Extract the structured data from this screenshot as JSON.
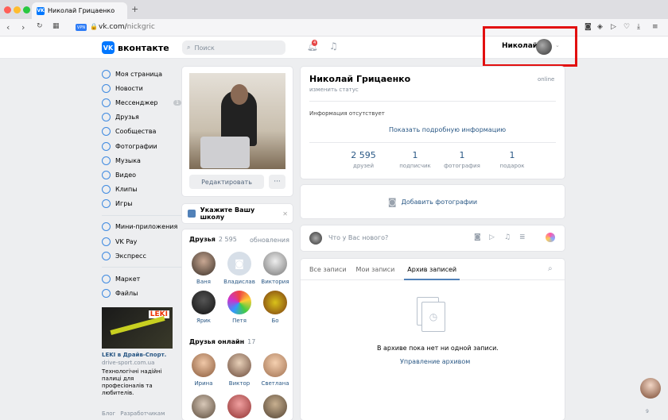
{
  "browser": {
    "tab_title": "Николай Грицаенко",
    "new_tab": "+",
    "url_host": "vk.com/",
    "url_path": "nickgric",
    "vpn": "VPN"
  },
  "header": {
    "logo_text": "вконтакте",
    "search_placeholder": "Поиск",
    "notif_count": "4",
    "user_name": "Николай"
  },
  "sidebar": {
    "items": [
      {
        "label": "Моя страница",
        "icon": "user-icon"
      },
      {
        "label": "Новости",
        "icon": "news-icon"
      },
      {
        "label": "Мессенджер",
        "icon": "chat-icon",
        "count": "1"
      },
      {
        "label": "Друзья",
        "icon": "friends-icon"
      },
      {
        "label": "Сообщества",
        "icon": "groups-icon"
      },
      {
        "label": "Фотографии",
        "icon": "photo-icon"
      },
      {
        "label": "Музыка",
        "icon": "music-icon"
      },
      {
        "label": "Видео",
        "icon": "video-icon"
      },
      {
        "label": "Клипы",
        "icon": "clips-icon"
      },
      {
        "label": "Игры",
        "icon": "games-icon"
      }
    ],
    "items2": [
      {
        "label": "Мини-приложения",
        "icon": "apps-icon"
      },
      {
        "label": "VK Pay",
        "icon": "pay-icon"
      },
      {
        "label": "Экспресс",
        "icon": "express-icon"
      }
    ],
    "items3": [
      {
        "label": "Маркет",
        "icon": "market-icon"
      },
      {
        "label": "Файлы",
        "icon": "files-icon"
      }
    ],
    "ad": {
      "brand": "LEKI",
      "title": "LEKI в Драйв-Спорт.",
      "domain": "drive-sport.com.ua",
      "text": "Технологічні надійні палиці для професіоналів та любителів."
    },
    "footer": [
      "Блог",
      "Разработчикам"
    ]
  },
  "profile": {
    "edit_label": "Редактировать",
    "more": "···",
    "school_label": "Укажите Вашу школу",
    "friends_title": "Друзья",
    "friends_count": "2 595",
    "friends_updates": "обновления",
    "friends": [
      {
        "name": "Ваня"
      },
      {
        "name": "Владислав"
      },
      {
        "name": "Виктория"
      },
      {
        "name": "Ярик"
      },
      {
        "name": "Петя"
      },
      {
        "name": "Бо"
      }
    ],
    "online_title": "Друзья онлайн",
    "online_count": "17",
    "online": [
      {
        "name": "Ирина"
      },
      {
        "name": "Виктор"
      },
      {
        "name": "Светлана"
      }
    ],
    "name": "Николай Грицаенко",
    "status": "изменить статус",
    "online_label": "online",
    "info_empty": "Информация отсутствует",
    "show_more": "Показать подробную информацию",
    "stats": [
      {
        "value": "2 595",
        "label": "друзей"
      },
      {
        "value": "1",
        "label": "подписчик"
      },
      {
        "value": "1",
        "label": "фотография"
      },
      {
        "value": "1",
        "label": "подарок"
      }
    ],
    "add_photos": "Добавить фотографии",
    "post_placeholder": "Что у Вас нового?",
    "tabs": [
      "Все записи",
      "Мои записи",
      "Архив записей"
    ],
    "archive_empty": "В архиве пока нет ни одной записи.",
    "archive_manage": "Управление архивом"
  },
  "chat": {
    "count": "9"
  }
}
